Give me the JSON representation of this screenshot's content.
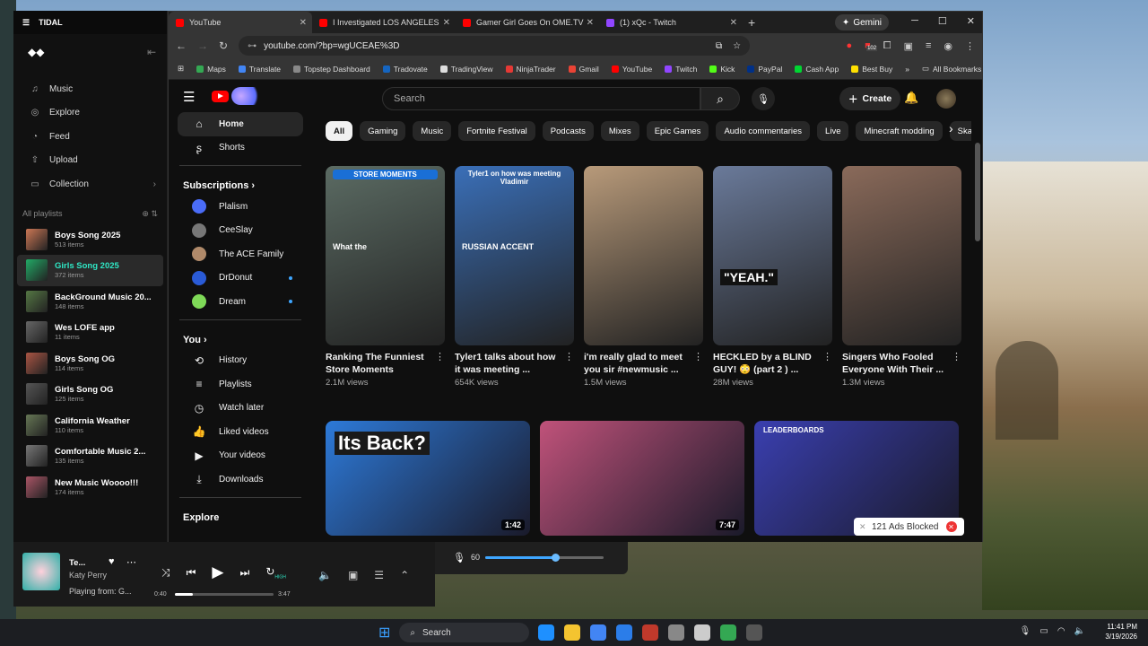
{
  "colors": {
    "yt_red": "#ff0000",
    "tidal_accent": "#2fe8c6",
    "link_blue": "#3ea6ff"
  },
  "browser": {
    "tabs": [
      {
        "label": "YouTube",
        "active": true,
        "color": "#ff0000"
      },
      {
        "label": "I Investigated LOS ANGELES as",
        "active": false,
        "color": "#ff0000"
      },
      {
        "label": "Gamer Girl Goes On OME.TV #",
        "active": false,
        "color": "#ff0000"
      },
      {
        "label": "(1) xQc - Twitch",
        "active": false,
        "color": "#9146ff"
      }
    ],
    "gemini_label": "Gemini",
    "url": "youtube.com/?bp=wgUCEAE%3D",
    "bookmarks": [
      "Maps",
      "Translate",
      "Topstep Dashboard",
      "Tradovate",
      "TradingView",
      "NinjaTrader",
      "Gmail",
      "YouTube",
      "Twitch",
      "Kick",
      "PayPal",
      "Cash App",
      "Best Buy"
    ],
    "all_bookmarks": "All Bookmarks",
    "ext_badge": "102"
  },
  "youtube": {
    "search_placeholder": "Search",
    "create_label": "Create",
    "sidebar": {
      "home": "Home",
      "shorts": "Shorts",
      "subscriptions_heading": "Subscriptions",
      "subscriptions": [
        {
          "name": "Plalism",
          "new": false,
          "color": "#4a6cf7"
        },
        {
          "name": "CeeSlay",
          "new": false,
          "color": "#777777"
        },
        {
          "name": "The ACE Family",
          "new": false,
          "color": "#b08a6a"
        },
        {
          "name": "DrDonut",
          "new": true,
          "color": "#2a5bd7"
        },
        {
          "name": "Dream",
          "new": true,
          "color": "#7ed957"
        }
      ],
      "you_heading": "You",
      "you_items": [
        "History",
        "Playlists",
        "Watch later",
        "Liked videos",
        "Your videos",
        "Downloads"
      ],
      "explore_heading": "Explore"
    },
    "chips": [
      "All",
      "Gaming",
      "Music",
      "Fortnite Festival",
      "Podcasts",
      "Mixes",
      "Epic Games",
      "Audio commentaries",
      "Live",
      "Minecraft modding",
      "Ska"
    ],
    "shorts_row": [
      {
        "title": "Ranking The Funniest Store Moments",
        "views": "2.1M views",
        "overlay": "STORE MOMENTS",
        "caption": "What the",
        "bg": "#5b6b63"
      },
      {
        "title": "Tyler1 talks about how it was meeting ...",
        "views": "654K views",
        "overlay": "Tyler1 on how was meeting Vladimir",
        "caption": "RUSSIAN ACCENT",
        "bg": "#3a6fb8"
      },
      {
        "title": "i'm really glad to meet you sir #newmusic ...",
        "views": "1.5M views",
        "overlay": "",
        "caption": "",
        "bg": "#b89a7a"
      },
      {
        "title": "HECKLED by a BLIND GUY! 😳 (part 2 ) ...",
        "views": "28M views",
        "overlay": "",
        "caption": "\"YEAH.\"",
        "bg": "#6a7a9a"
      },
      {
        "title": "Singers Who Fooled Everyone With Their ...",
        "views": "1.3M views",
        "overlay": "",
        "caption": "",
        "bg": "#8a6a5a"
      }
    ],
    "videos_row": [
      {
        "duration": "1:42",
        "overlay": "Its Back?",
        "bg": "#2d7ad9"
      },
      {
        "duration": "7:47",
        "overlay": "",
        "bg": "#c0527a"
      },
      {
        "duration": "",
        "overlay": "LEADERBOARDS",
        "bg": "#3a3fb0"
      }
    ],
    "ads_blocked": "121 Ads Blocked"
  },
  "tidal": {
    "app_title": "TIDAL",
    "nav": [
      "Music",
      "Explore",
      "Feed",
      "Upload",
      "Collection"
    ],
    "all_playlists": "All playlists",
    "playlists": [
      {
        "name": "Boys Song 2025",
        "count": "513 items",
        "active": false,
        "color": "#c75"
      },
      {
        "name": "Girls Song 2025",
        "count": "372 items",
        "active": true,
        "color": "#2a6"
      },
      {
        "name": "BackGround Music 20...",
        "count": "148 items",
        "active": false,
        "color": "#574"
      },
      {
        "name": "Wes LOFE app",
        "count": "11 items",
        "active": false,
        "color": "#666"
      },
      {
        "name": "Boys Song OG",
        "count": "114 items",
        "active": false,
        "color": "#a54"
      },
      {
        "name": "Girls Song OG",
        "count": "125 items",
        "active": false,
        "color": "#555"
      },
      {
        "name": "California Weather",
        "count": "110 items",
        "active": false,
        "color": "#675"
      },
      {
        "name": "Comfortable Music 2...",
        "count": "135 items",
        "active": false,
        "color": "#777"
      },
      {
        "name": "New Music Woooo!!!",
        "count": "174 items",
        "active": false,
        "color": "#a56"
      }
    ],
    "player": {
      "title": "Te...",
      "artist": "Katy Perry",
      "playing_from": "Playing from: G...",
      "elapsed": "0:40",
      "total": "3:47",
      "progress": 0.18,
      "quality": "HIGH"
    },
    "volume": {
      "value": "60",
      "level": 0.6
    }
  },
  "taskbar": {
    "search": "Search",
    "time": "11:41 PM",
    "date": "3/19/2026",
    "apps": [
      "#1e90ff",
      "#f4c430",
      "#4285f4",
      "#2b7de9",
      "#c0392b",
      "#888",
      "#ccc",
      "#34a853",
      "#555"
    ]
  }
}
